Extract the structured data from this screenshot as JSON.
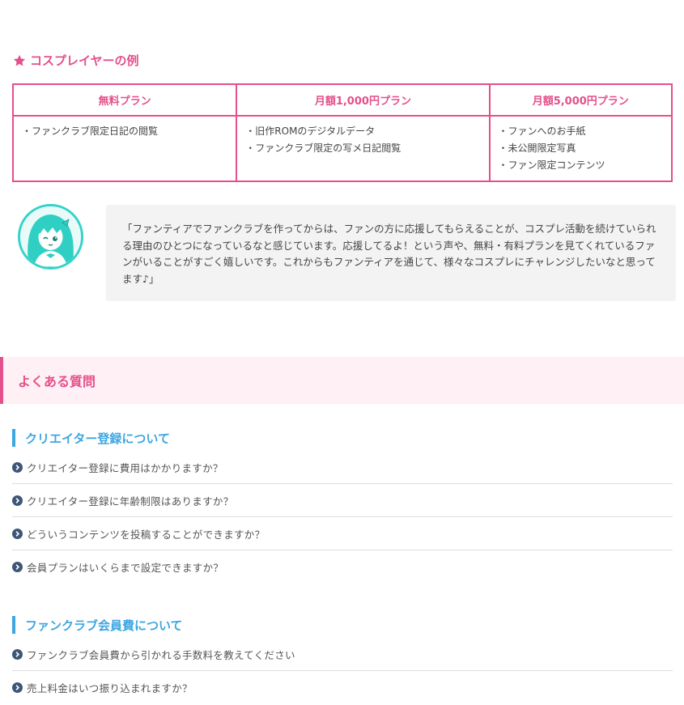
{
  "cosplay_section": {
    "icon": "star-icon",
    "title": "コスプレイヤーの例"
  },
  "plans_table": {
    "accent_color": "#e4508b",
    "headers": [
      "無料プラン",
      "月額1,000円プラン",
      "月額5,000円プラン"
    ],
    "columns": [
      [
        "・ファンクラブ限定日記の閲覧"
      ],
      [
        "・旧作ROMのデジタルデータ",
        "・ファンクラブ限定の写メ日記閲覧"
      ],
      [
        "・ファンへのお手紙",
        "・未公開限定写真",
        "・ファン限定コンテンツ"
      ]
    ]
  },
  "testimonial": {
    "avatar_icon": "cosplayer-avatar-icon",
    "quote": "「ファンティアでファンクラブを作ってからは、ファンの方に応援してもらえることが、コスプレ活動を続けていられる理由のひとつになっているなと感じています。応援してるよ！という声や、無料・有料プランを見てくれているファンがいることがすごく嬉しいです。これからもファンティアを通じて、様々なコスプレにチャレンジしたいなと思ってます♪」"
  },
  "faq": {
    "title": "よくある質問",
    "accent_color": "#3ea6e0",
    "groups": [
      {
        "title": "クリエイター登録について",
        "questions": [
          "クリエイター登録に費用はかかりますか？",
          "クリエイター登録に年齢制限はありますか？",
          "どういうコンテンツを投稿することができますか？",
          "会員プランはいくらまで設定できますか？"
        ]
      },
      {
        "title": "ファンクラブ会員費について",
        "questions": [
          "ファンクラブ会員費から引かれる手数料を教えてください",
          "売上料金はいつ振り込まれますか？"
        ]
      }
    ]
  }
}
